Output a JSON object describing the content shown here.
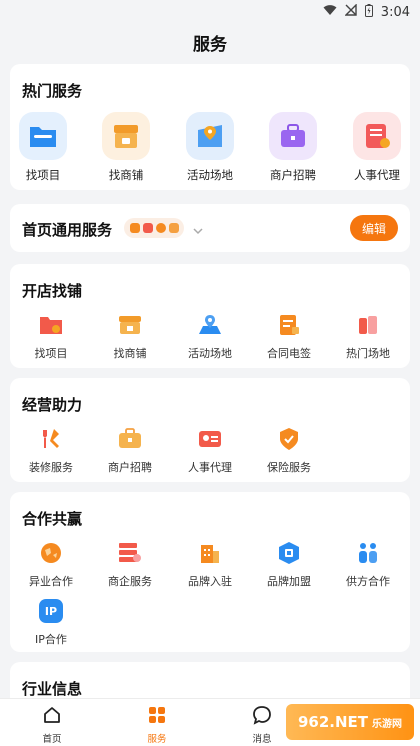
{
  "status_bar": {
    "time": "3:04"
  },
  "page_title": "服务",
  "hot_services": {
    "title": "热门服务",
    "items": [
      {
        "label": "找项目",
        "icon": "folder-icon",
        "color": "#2a8cf0"
      },
      {
        "label": "找商铺",
        "icon": "storefront-icon",
        "color": "#f5a623"
      },
      {
        "label": "活动场地",
        "icon": "map-pin-icon",
        "color": "#2a8cf0"
      },
      {
        "label": "商户招聘",
        "icon": "briefcase-icon",
        "color": "#8c56e8"
      },
      {
        "label": "人事代理",
        "icon": "id-card-icon",
        "color": "#f25a5a"
      }
    ]
  },
  "common_services": {
    "title": "首页通用服务",
    "edit_label": "编辑"
  },
  "open_store": {
    "title": "开店找铺",
    "items": [
      {
        "label": "找项目",
        "icon": "folder-icon",
        "color": "#f25a4a"
      },
      {
        "label": "找商铺",
        "icon": "storefront-icon",
        "color": "#f5a040"
      },
      {
        "label": "活动场地",
        "icon": "map-pin-icon",
        "color": "#2a8cf0"
      },
      {
        "label": "合同电签",
        "icon": "contract-icon",
        "color": "#f58a20"
      },
      {
        "label": "热门场地",
        "icon": "venue-icon",
        "color": "#f25a4a"
      }
    ]
  },
  "business_help": {
    "title": "经营助力",
    "items": [
      {
        "label": "装修服务",
        "icon": "tools-icon",
        "color": "#f25a4a"
      },
      {
        "label": "商户招聘",
        "icon": "briefcase-icon",
        "color": "#f5a040"
      },
      {
        "label": "人事代理",
        "icon": "id-card-icon",
        "color": "#f25a4a"
      },
      {
        "label": "保险服务",
        "icon": "shield-icon",
        "color": "#f58a20"
      }
    ]
  },
  "cooperation": {
    "title": "合作共赢",
    "items": [
      {
        "label": "异业合作",
        "icon": "globe-icon",
        "color": "#f58a20"
      },
      {
        "label": "商企服务",
        "icon": "server-icon",
        "color": "#f25a4a"
      },
      {
        "label": "品牌入驻",
        "icon": "building-icon",
        "color": "#f58a20"
      },
      {
        "label": "品牌加盟",
        "icon": "brand-icon",
        "color": "#2a8cf0"
      },
      {
        "label": "供方合作",
        "icon": "people-icon",
        "color": "#2a8cf0"
      },
      {
        "label": "IP合作",
        "icon": "ip-icon",
        "color": "#2a8cf0",
        "glyph": "IP"
      }
    ]
  },
  "industry_info": {
    "title": "行业信息"
  },
  "bottom_nav": {
    "items": [
      {
        "label": "首页",
        "icon": "home-icon"
      },
      {
        "label": "服务",
        "icon": "grid-icon"
      },
      {
        "label": "消息",
        "icon": "chat-icon"
      }
    ]
  },
  "watermark": {
    "text": "962.NET",
    "sub": "乐游网"
  },
  "colors": {
    "accent": "#f5760f",
    "background": "#f3f4f6"
  }
}
